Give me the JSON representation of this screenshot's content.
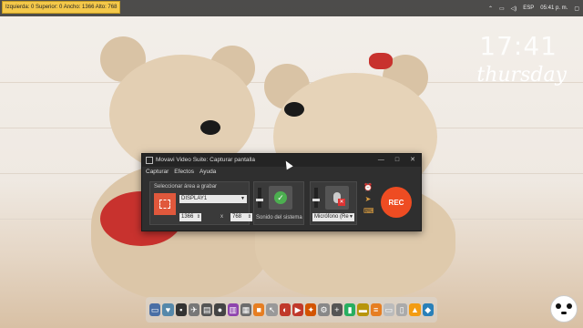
{
  "overlay": {
    "selection_info": "Izquierda: 0  Superior: 0  Ancho: 1366  Alto: 768"
  },
  "system_tray": {
    "language": "ESP",
    "time": "05:41 p. m."
  },
  "desktop_clock": {
    "time": "17:41",
    "day": "thursday"
  },
  "window": {
    "title": "Movavi Video Suite: Capturar pantalla",
    "controls": {
      "minimize": "—",
      "maximize": "□",
      "close": "✕"
    },
    "menu": [
      "Capturar",
      "Efectos",
      "Ayuda"
    ],
    "area_section": {
      "label": "Seleccionar área a grabar",
      "display_value": "DISPLAY1",
      "width": "1366",
      "times": "x",
      "height": "768"
    },
    "system_sound": {
      "label": "Sonido del sistema",
      "enabled": true
    },
    "microphone": {
      "value": "Micrófono (Re"
    },
    "rec_label": "REC"
  },
  "colors": {
    "accent": "#ee4c22",
    "window_bg": "#2f2f2f",
    "selection_label_bg": "#f4c84a"
  }
}
